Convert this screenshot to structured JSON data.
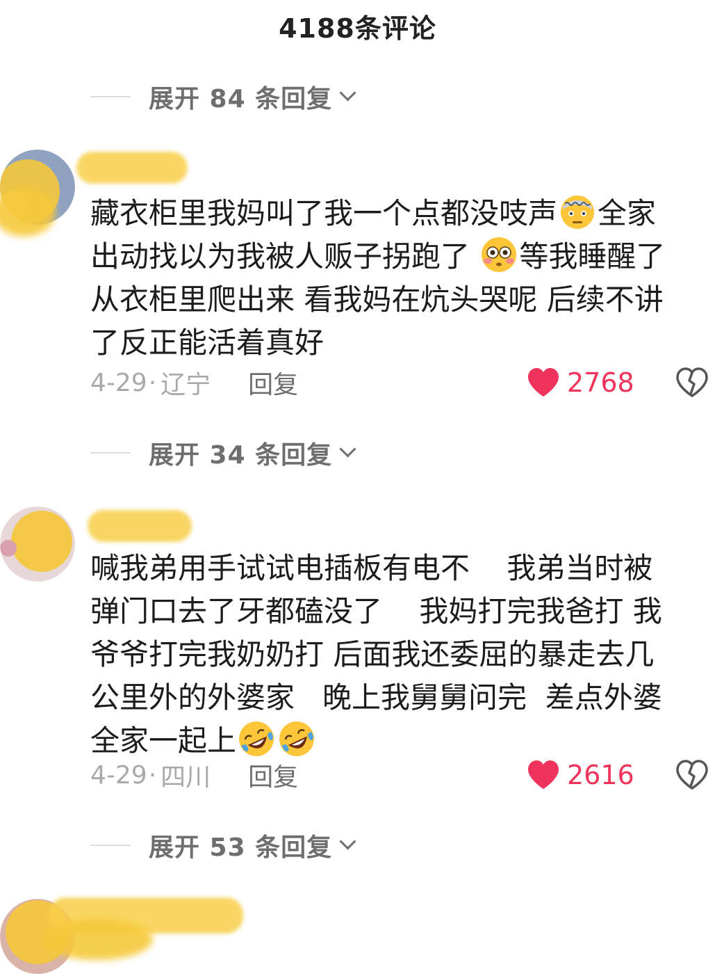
{
  "header": {
    "title": "4188条评论"
  },
  "expands": [
    {
      "label": "展开 84 条回复"
    },
    {
      "label": "展开 34 条回复"
    },
    {
      "label": "展开 53 条回复"
    }
  ],
  "comments": [
    {
      "lines": [
        [
          "藏衣柜里我妈叫了我一个点都没吱声",
          "emoji:dizzy-face",
          "全家"
        ],
        [
          "出动找以为我被人贩子拐跑了 ",
          "emoji:flushed-face",
          "等我睡醒了"
        ],
        [
          "从衣柜里爬出来 看我妈在炕头哭呢 后续不讲"
        ],
        [
          "了反正能活着真好"
        ]
      ],
      "date": "4-29",
      "location": "辽宁",
      "reply_label": "回复",
      "likes": "2768"
    },
    {
      "lines": [
        [
          "喊我弟用手试试电插板有电不    我弟当时被"
        ],
        [
          "弹门口去了牙都磕没了    我妈打完我爸打 我"
        ],
        [
          "爷爷打完我奶奶打 后面我还委屈的暴走去几"
        ],
        [
          "公里外的外婆家   晚上我舅舅问完  差点外婆"
        ],
        [
          "全家一起上",
          "emoji:rofl-face",
          "emoji:rofl-face"
        ]
      ],
      "date": "4-29",
      "location": "四川",
      "reply_label": "回复",
      "likes": "2616"
    }
  ],
  "partial_comment": {
    "text": ""
  },
  "colors": {
    "like": "#f0335a",
    "muted": "#a9a9a9",
    "secondary": "#6e6e6e"
  }
}
